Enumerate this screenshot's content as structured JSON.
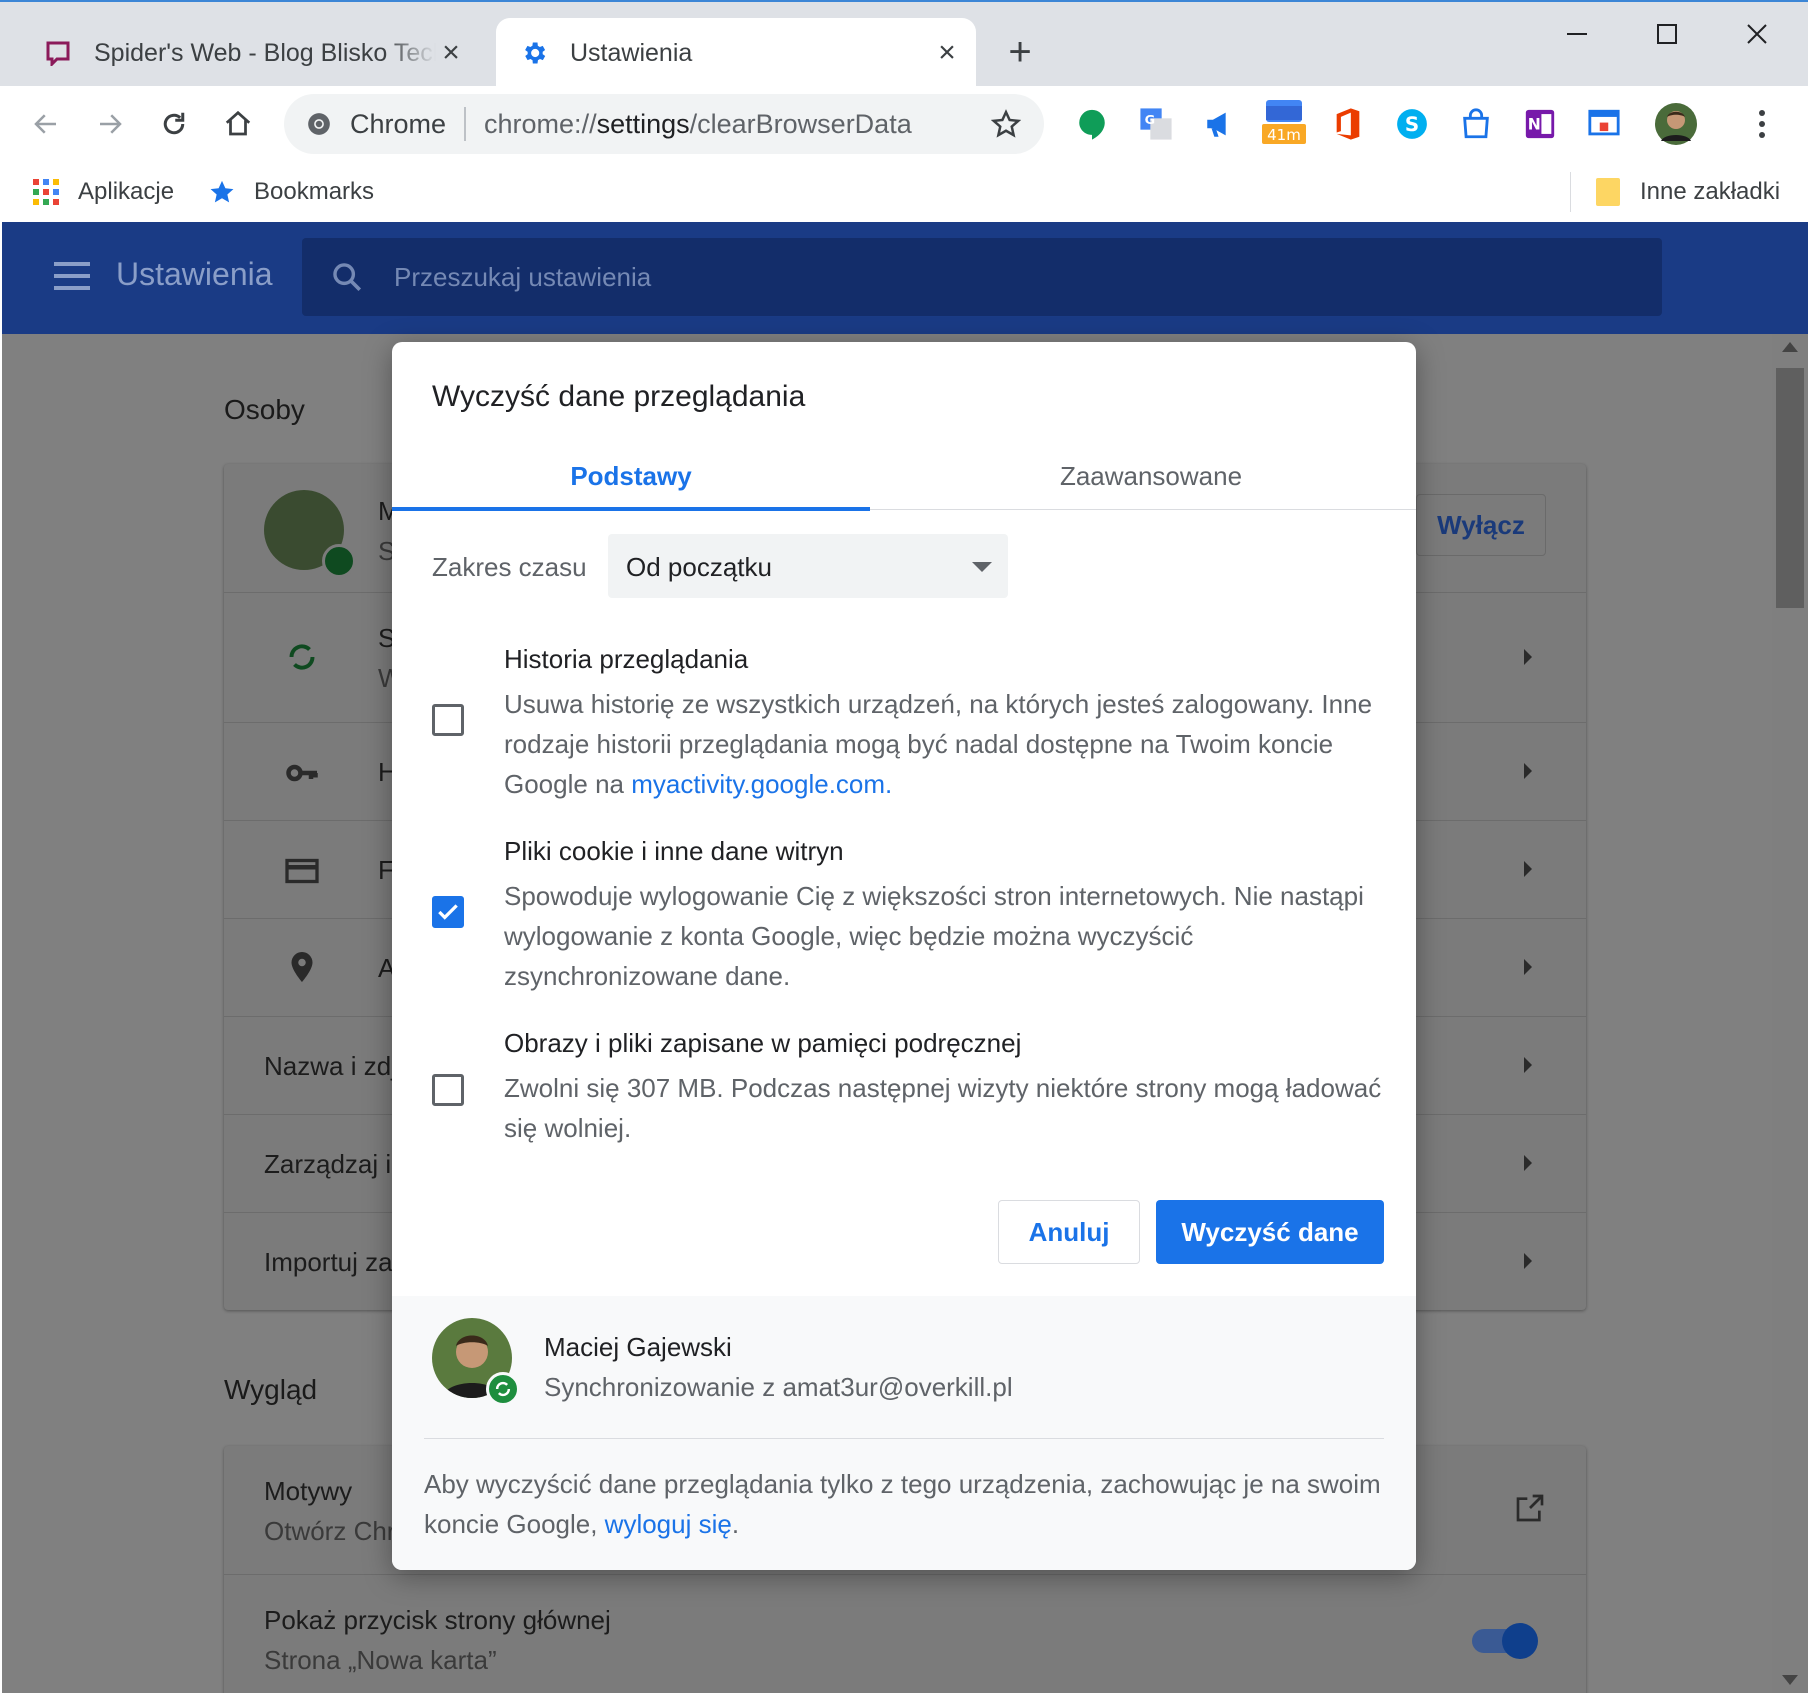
{
  "tabs": [
    {
      "title": "Spider's Web - Blog Blisko Technologii",
      "favicon": "spidersweb-favicon"
    },
    {
      "title": "Ustawienia",
      "favicon": "gear-icon"
    }
  ],
  "omnibox": {
    "security_label": "Chrome",
    "url_prefix": "chrome://",
    "url_host": "settings",
    "url_path": "/clearBrowserData"
  },
  "extensions": {
    "calendar_badge": "41m"
  },
  "bookmarks": {
    "apps": "Aplikacje",
    "bookmarks": "Bookmarks",
    "other": "Inne zakładki"
  },
  "settings_header": {
    "title": "Ustawienia",
    "search_placeholder": "Przeszukaj ustawienia"
  },
  "background": {
    "people_title": "Osoby",
    "people_name_initial": "M",
    "people_sub_initial": "S",
    "turn_off": "Wyłącz",
    "sync_initial": "S",
    "sync_sub_initial": "W",
    "passwords_initial": "H",
    "payments_initial": "F",
    "addresses_initial": "A",
    "name_row": "Nazwa i zdj",
    "manage_row": "Zarządzaj i",
    "import_row": "Importuj za",
    "appearance_title": "Wygląd",
    "themes": "Motywy",
    "themes_sub": "Otwórz Chr",
    "home_button": "Pokaż przycisk strony głównej",
    "home_button_sub": "Strona „Nowa karta”"
  },
  "dialog": {
    "title": "Wyczyść dane przeglądania",
    "tab_basic": "Podstawy",
    "tab_advanced": "Zaawansowane",
    "range_label": "Zakres czasu",
    "range_value": "Od początku",
    "options": [
      {
        "label": "Historia przeglądania",
        "desc": "Usuwa historię ze wszystkich urządzeń, na których jesteś zalogowany. Inne rodzaje historii przeglądania mogą być nadal dostępne na Twoim koncie Google na ",
        "link": "myactivity.google.com.",
        "checked": false
      },
      {
        "label": "Pliki cookie i inne dane witryn",
        "desc": "Spowoduje wylogowanie Cię z większości stron internetowych. Nie nastąpi wylogowanie z konta Google, więc będzie można wyczyścić zsynchronizowane dane.",
        "checked": true
      },
      {
        "label": "Obrazy i pliki zapisane w pamięci podręcznej",
        "desc": "Zwolni się 307 MB. Podczas następnej wizyty niektóre strony mogą ładować się wolniej.",
        "checked": false
      }
    ],
    "cancel": "Anuluj",
    "clear": "Wyczyść dane",
    "account_name": "Maciej Gajewski",
    "account_sync": "Synchronizowanie z amat3ur@overkill.pl",
    "note_text": "Aby wyczyścić dane przeglądania tylko z tego urządzenia, zachowując je na swoim koncie Google, ",
    "note_link": "wyloguj się",
    "note_end": "."
  },
  "colors": {
    "accent": "#1a73e8",
    "header": "#1a3b85",
    "sync_green": "#1e8e3e"
  }
}
